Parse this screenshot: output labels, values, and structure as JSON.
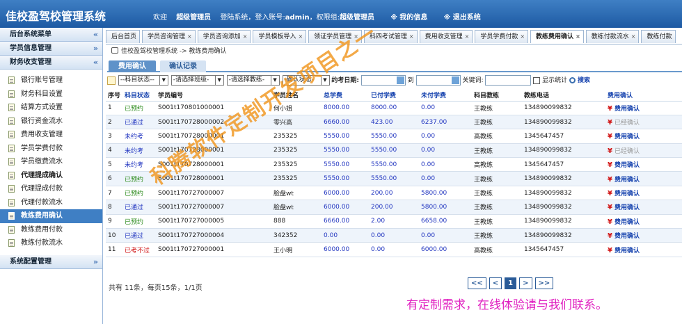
{
  "app": {
    "title": "佳校盈驾校管理系统",
    "welcome_prefix": "欢迎",
    "username": "超级管理员",
    "login_text": "登陆系统，登入账号:",
    "account": "admin",
    "perm_text": "，权限组:",
    "group": "超级管理员",
    "my_info": "※ 我的信息",
    "logout": "※ 退出系统"
  },
  "sidebar": {
    "headers": [
      "后台系统菜单",
      "学员信息管理",
      "财务收支管理",
      "系统配置管理"
    ],
    "items": [
      {
        "label": "银行账号管理"
      },
      {
        "label": "财务科目设置"
      },
      {
        "label": "结算方式设置"
      },
      {
        "label": "银行资金流水"
      },
      {
        "label": "费用收支管理"
      },
      {
        "label": "学员学费付款"
      },
      {
        "label": "学员缴费流水"
      },
      {
        "label": "代理提成确认"
      },
      {
        "label": "代理提成付款"
      },
      {
        "label": "代理付款流水"
      },
      {
        "label": "教练费用确认"
      },
      {
        "label": "教练费用付款"
      },
      {
        "label": "教练付款流水"
      }
    ]
  },
  "tabs": [
    {
      "label": "后台首页",
      "closable": false
    },
    {
      "label": "学员咨询管理",
      "closable": true
    },
    {
      "label": "学员咨询添加",
      "closable": true
    },
    {
      "label": "学员模板导入",
      "closable": true
    },
    {
      "label": "领证学员管理",
      "closable": true
    },
    {
      "label": "科四考试管理",
      "closable": true
    },
    {
      "label": "费用收支管理",
      "closable": true
    },
    {
      "label": "学员学费付款",
      "closable": true
    },
    {
      "label": "教练费用确认",
      "closable": true
    },
    {
      "label": "教练付款流水",
      "closable": true
    },
    {
      "label": "教练付款",
      "closable": false
    }
  ],
  "breadcrumb": "佳校盈驾校管理系统 -> 教练费用确认",
  "subtabs": [
    "费用确认",
    "确认记录"
  ],
  "filters": {
    "subject_state": "--科目状态--",
    "class": "-请选择班级-",
    "coach": "-请选择教练-",
    "confirm_state": "-确认状态-",
    "exam_date_label": "约考日期:",
    "to_label": "到",
    "keyword_label": "关键词:",
    "show_stats": "显示统计",
    "search": "搜索"
  },
  "columns": [
    "序号",
    "科目状态",
    "学员编号",
    "学员姓名",
    "总学费",
    "已付学费",
    "未付学费",
    "科目教练",
    "教练电话",
    "费用确认"
  ],
  "rows": [
    {
      "no": "1",
      "status": "已预约",
      "sc": "green",
      "id": "S001t170801000001",
      "name": "何小姐",
      "total": "8000.00",
      "paid": "8000.00",
      "unpaid": "0.00",
      "coach": "王教练",
      "phone": "134890099832",
      "confirm": "费用确认",
      "cc": "on"
    },
    {
      "no": "2",
      "status": "已通过",
      "sc": "blue",
      "id": "S001t170728000002",
      "name": "零兴高",
      "total": "6660.00",
      "paid": "423.00",
      "unpaid": "6237.00",
      "coach": "王教练",
      "phone": "134890099832",
      "confirm": "已经确认",
      "cc": "off"
    },
    {
      "no": "3",
      "status": "未约考",
      "sc": "blue",
      "id": "S001t170728000001",
      "name": "235325",
      "total": "5550.00",
      "paid": "5550.00",
      "unpaid": "0.00",
      "coach": "高教练",
      "phone": "1345647457",
      "confirm": "费用确认",
      "cc": "on"
    },
    {
      "no": "4",
      "status": "未约考",
      "sc": "blue",
      "id": "S001t170728000001",
      "name": "235325",
      "total": "5550.00",
      "paid": "5550.00",
      "unpaid": "0.00",
      "coach": "王教练",
      "phone": "134890099832",
      "confirm": "已经确认",
      "cc": "off"
    },
    {
      "no": "5",
      "status": "未约考",
      "sc": "blue",
      "id": "S001t170728000001",
      "name": "235325",
      "total": "5550.00",
      "paid": "5550.00",
      "unpaid": "0.00",
      "coach": "高教练",
      "phone": "1345647457",
      "confirm": "费用确认",
      "cc": "on"
    },
    {
      "no": "6",
      "status": "已预约",
      "sc": "green",
      "id": "S001t170728000001",
      "name": "235325",
      "total": "5550.00",
      "paid": "5550.00",
      "unpaid": "0.00",
      "coach": "王教练",
      "phone": "134890099832",
      "confirm": "费用确认",
      "cc": "on"
    },
    {
      "no": "7",
      "status": "已预约",
      "sc": "green",
      "id": "S001t170727000007",
      "name": "脸盘wt",
      "total": "6000.00",
      "paid": "200.00",
      "unpaid": "5800.00",
      "coach": "王教练",
      "phone": "134890099832",
      "confirm": "费用确认",
      "cc": "on"
    },
    {
      "no": "8",
      "status": "已通过",
      "sc": "blue",
      "id": "S001t170727000007",
      "name": "脸盘wt",
      "total": "6000.00",
      "paid": "200.00",
      "unpaid": "5800.00",
      "coach": "王教练",
      "phone": "134890099832",
      "confirm": "费用确认",
      "cc": "on"
    },
    {
      "no": "9",
      "status": "已预约",
      "sc": "green",
      "id": "S001t170727000005",
      "name": "888",
      "total": "6660.00",
      "paid": "2.00",
      "unpaid": "6658.00",
      "coach": "王教练",
      "phone": "134890099832",
      "confirm": "费用确认",
      "cc": "on"
    },
    {
      "no": "10",
      "status": "已通过",
      "sc": "blue",
      "id": "S001t170727000004",
      "name": "342352",
      "total": "0.00",
      "paid": "0.00",
      "unpaid": "0.00",
      "coach": "王教练",
      "phone": "134890099832",
      "confirm": "费用确认",
      "cc": "on"
    },
    {
      "no": "11",
      "status": "已考不过",
      "sc": "red",
      "id": "S001t170727000001",
      "name": "王小明",
      "total": "6000.00",
      "paid": "0.00",
      "unpaid": "6000.00",
      "coach": "高教练",
      "phone": "1345647457",
      "confirm": "费用确认",
      "cc": "on"
    }
  ],
  "footer": {
    "summary": "共有 11条，每页15条，1/1页"
  },
  "pager": {
    "first": "<<",
    "prev": "<",
    "current": "1",
    "next": ">",
    "last": ">>"
  },
  "watermark": "科腾软件定制开发项目之一",
  "promo": "有定制需求，在线体验请与我们联系。",
  "yen_symbol": "¥"
}
